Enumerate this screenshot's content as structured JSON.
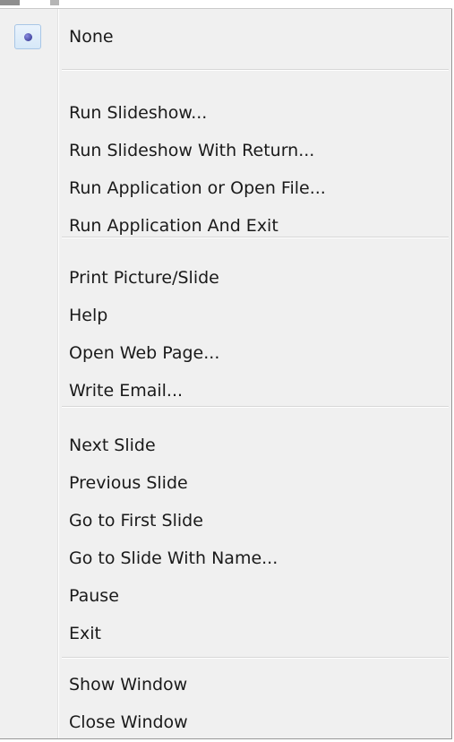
{
  "menu": {
    "selected_item": "None",
    "groups": [
      {
        "items": [
          {
            "label": "None",
            "checked": true
          }
        ]
      },
      {
        "items": [
          {
            "label": "Run Slideshow..."
          },
          {
            "label": "Run Slideshow With Return..."
          },
          {
            "label": "Run Application or Open File..."
          },
          {
            "label": "Run Application And Exit"
          }
        ]
      },
      {
        "items": [
          {
            "label": "Print Picture/Slide"
          },
          {
            "label": "Help"
          },
          {
            "label": "Open Web Page..."
          },
          {
            "label": "Write Email..."
          }
        ]
      },
      {
        "items": [
          {
            "label": "Next Slide"
          },
          {
            "label": "Previous Slide"
          },
          {
            "label": "Go to First Slide"
          },
          {
            "label": "Go to Slide With Name..."
          },
          {
            "label": "Pause"
          },
          {
            "label": "Exit"
          }
        ]
      },
      {
        "items": [
          {
            "label": "Show Window"
          },
          {
            "label": "Close Window"
          }
        ]
      }
    ]
  },
  "colors": {
    "menu_background": "#f0f0f0",
    "text": "#1a1a1a",
    "radio_dot": "#2a2c88",
    "separator": "#d7d7d7"
  },
  "icons": {
    "checked_indicator": "radio-dot-icon"
  }
}
